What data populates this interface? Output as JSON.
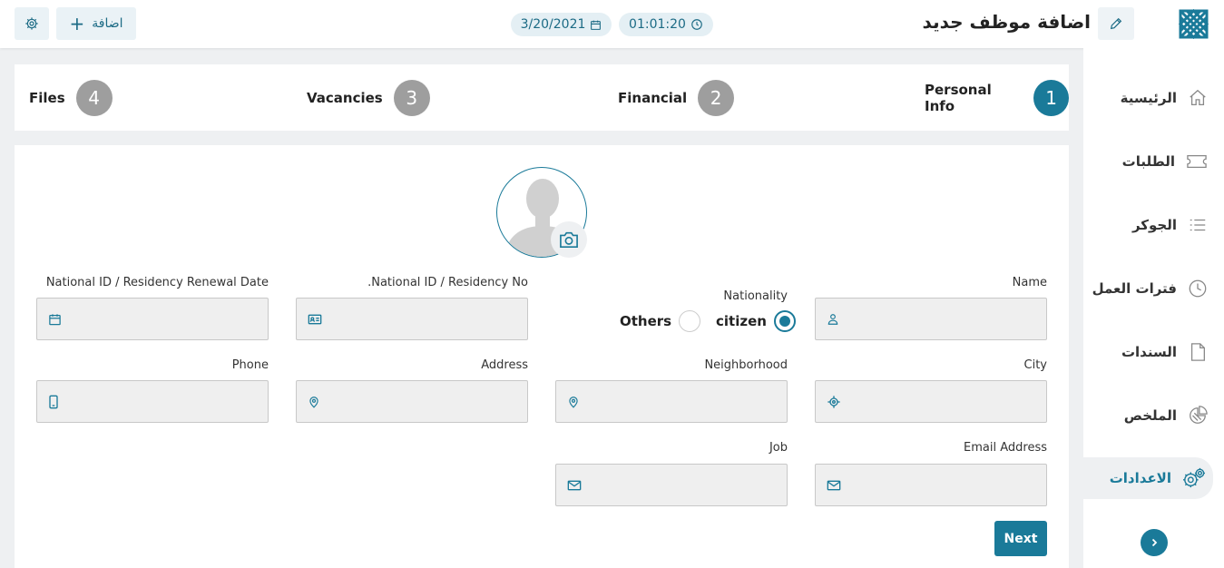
{
  "header": {
    "title": "اضافة موظف جديد",
    "add_label": "اضافة",
    "date": "3/20/2021",
    "time": "01:01:20",
    "icons": {
      "settings": "gear-icon",
      "add": "plus-icon",
      "date": "calendar-icon",
      "time": "clock-icon",
      "edit": "pencil-icon",
      "logo": "logo-icon"
    }
  },
  "sidebar": {
    "items": [
      {
        "label": "الرئيسية",
        "icon": "home-icon",
        "active": false
      },
      {
        "label": "الطلبات",
        "icon": "ticket-icon",
        "active": false
      },
      {
        "label": "الجوكر",
        "icon": "list-icon",
        "active": false
      },
      {
        "label": "فترات العمل",
        "icon": "clock-icon",
        "active": false
      },
      {
        "label": "السندات",
        "icon": "document-icon",
        "active": false
      },
      {
        "label": "الملخص",
        "icon": "pie-chart-icon",
        "active": false
      },
      {
        "label": "الاعدادات",
        "icon": "gears-icon",
        "active": true
      }
    ],
    "collapse_icon": "chevron-right-icon"
  },
  "steps": [
    {
      "number": "1",
      "label": "Personal Info",
      "active": true
    },
    {
      "number": "2",
      "label": "Financial",
      "active": false
    },
    {
      "number": "3",
      "label": "Vacancies",
      "active": false
    },
    {
      "number": "4",
      "label": "Files",
      "active": false
    }
  ],
  "form": {
    "fields": {
      "name": {
        "label": "Name",
        "value": "",
        "icon": "user-icon"
      },
      "nationality": {
        "label": "Nationality",
        "options": [
          "citizen",
          "Others"
        ],
        "selected": "citizen"
      },
      "national_id": {
        "label": ".National ID / Residency No",
        "value": "",
        "icon": "id-card-icon"
      },
      "renewal_date": {
        "label": "National ID / Residency Renewal Date",
        "value": "",
        "icon": "calendar-icon"
      },
      "city": {
        "label": "City",
        "value": "",
        "icon": "target-icon"
      },
      "neighborhood": {
        "label": "Neighborhood",
        "value": "",
        "icon": "map-pin-icon"
      },
      "address": {
        "label": "Address",
        "value": "",
        "icon": "map-pin-icon"
      },
      "phone": {
        "label": "Phone",
        "value": "",
        "icon": "mobile-icon"
      },
      "email": {
        "label": "Email Address",
        "value": "",
        "icon": "envelope-icon"
      },
      "job": {
        "label": "Job",
        "value": "",
        "icon": "envelope-icon"
      }
    },
    "next_label": "Next",
    "camera_icon": "camera-icon",
    "avatar_icon": "user-avatar-icon"
  },
  "colors": {
    "primary": "#1a7a99",
    "step_inactive": "#9e9e9e",
    "field_bg": "#efefef",
    "page_bg": "#eef0f2"
  }
}
